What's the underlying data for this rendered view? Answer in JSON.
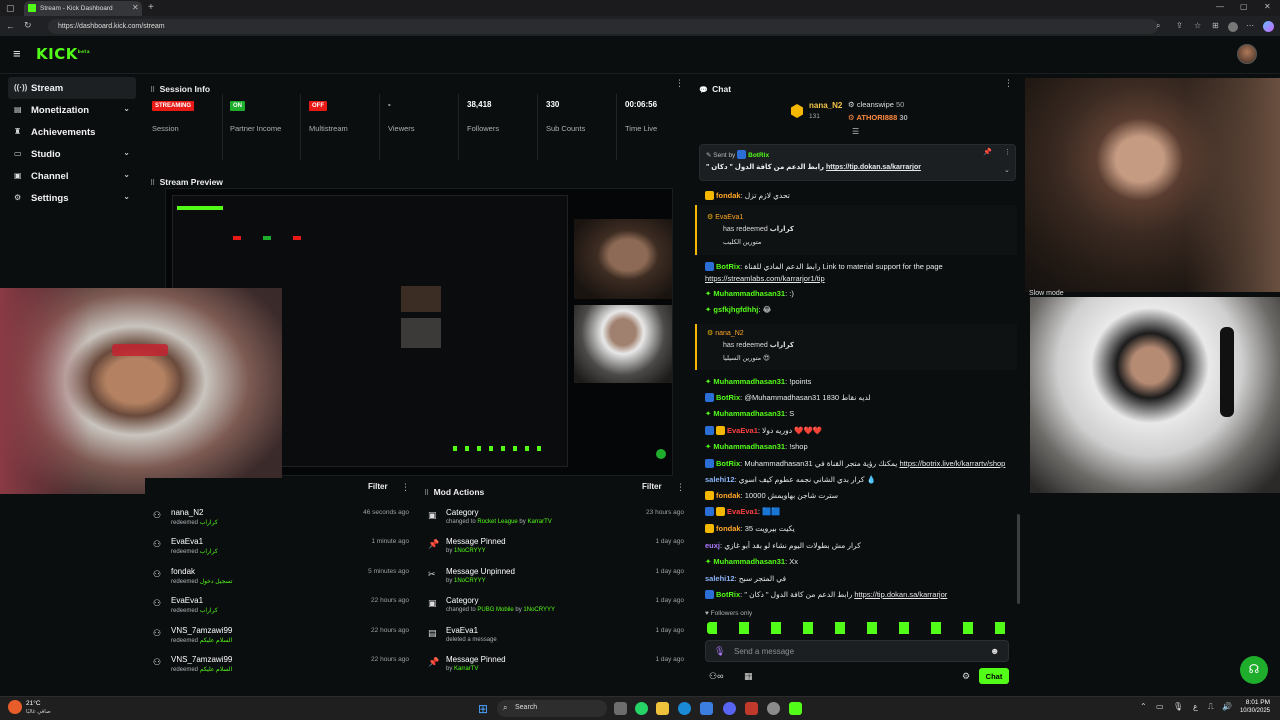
{
  "browser": {
    "tab_title": "Stream - Kick Dashboard",
    "url": "https://dashboard.kick.com/stream"
  },
  "header": {
    "logo": "KICK",
    "logo_sup": "beta"
  },
  "sidebar": {
    "items": [
      {
        "label": "Stream",
        "icon": "stream-icon",
        "active": true
      },
      {
        "label": "Monetization",
        "icon": "money-icon",
        "expandable": true
      },
      {
        "label": "Achievements",
        "icon": "trophy-icon"
      },
      {
        "label": "Studio",
        "icon": "studio-icon",
        "expandable": true
      },
      {
        "label": "Channel",
        "icon": "channel-icon",
        "expandable": true
      },
      {
        "label": "Settings",
        "icon": "gear-icon",
        "expandable": true
      }
    ]
  },
  "session": {
    "title": "Session Info",
    "stats": [
      {
        "value": "STREAMING",
        "label": "Session",
        "badge": "#e91916"
      },
      {
        "value": "ON",
        "label": "Partner Income",
        "badge": "#1fad2c"
      },
      {
        "value": "OFF",
        "label": "Multistream",
        "badge": "#e91916"
      },
      {
        "value": "-",
        "label": "Viewers"
      },
      {
        "value": "38,418",
        "label": "Followers"
      },
      {
        "value": "330",
        "label": "Sub Counts"
      },
      {
        "value": "00:06:56",
        "label": "Time Live"
      }
    ]
  },
  "preview": {
    "title": "Stream Preview"
  },
  "events": {
    "filter": "Filter",
    "rows": [
      {
        "name": "nana_N2",
        "action": "redeemed",
        "reward": "كراراب",
        "time": "46 seconds ago"
      },
      {
        "name": "EvaEva1",
        "action": "redeemed",
        "reward": "كراراب",
        "time": "1 minute ago"
      },
      {
        "name": "fondak",
        "action": "redeemed",
        "reward": "تسجيل دخول",
        "time": "5 minutes ago"
      },
      {
        "name": "EvaEva1",
        "action": "redeemed",
        "reward": "كراراب",
        "time": "22 hours ago"
      },
      {
        "name": "VNS_7amzawi99",
        "action": "redeemed",
        "reward": "السلام عليكم",
        "time": "22 hours ago"
      },
      {
        "name": "VNS_7amzawi99",
        "action": "redeemed",
        "reward": "السلام عليكم",
        "time": "22 hours ago"
      }
    ]
  },
  "mod_actions": {
    "title": "Mod Actions",
    "filter": "Filter",
    "rows": [
      {
        "icon": "category-icon",
        "title": "Category",
        "line1": "changed to",
        "target": "Rocket League",
        "by": "by",
        "actor": "KarrarTV",
        "time": "23 hours ago"
      },
      {
        "icon": "pin-icon",
        "title": "Message Pinned",
        "line1": "by",
        "target": "1NoCRYYY",
        "by": "",
        "actor": "",
        "time": "1 day ago"
      },
      {
        "icon": "unpin-icon",
        "title": "Message Unpinned",
        "line1": "by",
        "target": "1NoCRYYY",
        "by": "",
        "actor": "",
        "time": "1 day ago"
      },
      {
        "icon": "category-icon",
        "title": "Category",
        "line1": "changed to",
        "target": "PUBG Mobile",
        "by": "by",
        "actor": "1NoCRYYY",
        "time": "1 day ago"
      },
      {
        "icon": "user-icon",
        "title": "EvaEva1",
        "line1": "deleted a message",
        "target": "",
        "by": "",
        "actor": "",
        "time": "1 day ago"
      },
      {
        "icon": "pin-icon",
        "title": "Message Pinned",
        "line1": "by",
        "target": "KarrarTV",
        "by": "",
        "actor": "",
        "time": "1 day ago"
      }
    ]
  },
  "chat": {
    "title": "Chat",
    "top_gifter": {
      "name": "nana_N2",
      "count": "131"
    },
    "gifters": [
      {
        "name": "cleanswipe",
        "count": "50"
      },
      {
        "name": "ATHORI888",
        "count": "30"
      }
    ],
    "pinned": {
      "sent_by": "Sent by",
      "user": "BotRix",
      "text": "\" رابط الدعم من كافة الدول \" دكان",
      "link": "https://tip.dokan.sa/karrarjor"
    },
    "messages": [
      {
        "user": "fondak",
        "color": "o",
        "text": "تحدي لازم تزل"
      },
      {
        "type": "redeem",
        "user": "EvaEva1",
        "action": "has redeemed",
        "reward": "كراراب",
        "note": "متورين الكليب"
      },
      {
        "user": "BotRix",
        "color": "g",
        "text": "رابط الدعم المادي للقناة Link to material support for the page"
      },
      {
        "type": "link",
        "text": "https://streamlabs.com/karrarjor1/tip"
      },
      {
        "user": "Muhammadhasan31",
        "color": "g",
        "text": ":)"
      },
      {
        "user": "gsfkjhgfdhhj",
        "color": "g",
        "text": "😂"
      },
      {
        "type": "redeem",
        "user": "nana_N2",
        "action": "has redeemed",
        "reward": "كراراب",
        "note": "متورين السيليا 😍"
      },
      {
        "user": "Muhammadhasan31",
        "color": "g",
        "text": "!points"
      },
      {
        "user": "BotRix",
        "color": "g",
        "text": "@Muhammadhasan31 1830 لديه نقاط"
      },
      {
        "user": "Muhammadhasan31",
        "color": "g",
        "text": "S"
      },
      {
        "user": "EvaEva1",
        "color": "r",
        "text": "دوريه دولا ❤️❤️❤️"
      },
      {
        "user": "Muhammadhasan31",
        "color": "g",
        "text": "!shop"
      },
      {
        "user": "BotRix",
        "color": "g",
        "text": "Muhammadhasan31 يمكنك رؤية متجر القناة في",
        "link": "https://botrix.live/k/karrartv/shop"
      },
      {
        "user": "salehi12",
        "color": "b",
        "text": "كرار بدي الشاني نجمه عطوم كيف اسوي 💧"
      },
      {
        "user": "fondak",
        "color": "o",
        "text": "10000 سترت شاجن بهاويمش"
      },
      {
        "user": "EvaEva1",
        "color": "r",
        "text": "🟦🟦"
      },
      {
        "user": "fondak",
        "color": "o",
        "text": "35 يكيت بيرويت"
      },
      {
        "user": "euxj",
        "color": "p",
        "text": "كرار مش بطولات اليوم نشاء لو بقد أبو غازي"
      },
      {
        "user": "Muhammadhasan31",
        "color": "g",
        "text": "Xx"
      },
      {
        "user": "salehi12",
        "color": "b",
        "text": "في المتجر سبح"
      },
      {
        "user": "BotRix",
        "color": "g",
        "text": "\" رابط الدعم من كافة الدول \" دكان",
        "link": "https://tip.dokan.sa/karrarjor"
      }
    ],
    "followers_only": "Followers only",
    "input_placeholder": "Send a message",
    "send_label": "Chat"
  },
  "side_cams": {
    "slow_mode": "Slow mode"
  },
  "taskbar": {
    "weather": "21°C",
    "weather_sub": "صافي غالبًا",
    "search": "Search",
    "lang": "ع",
    "time": "8:01 PM",
    "date": "10/30/2025"
  },
  "colors": {
    "accent": "#53fc18",
    "bg": "#0b0e0f",
    "streaming": "#e91916"
  }
}
